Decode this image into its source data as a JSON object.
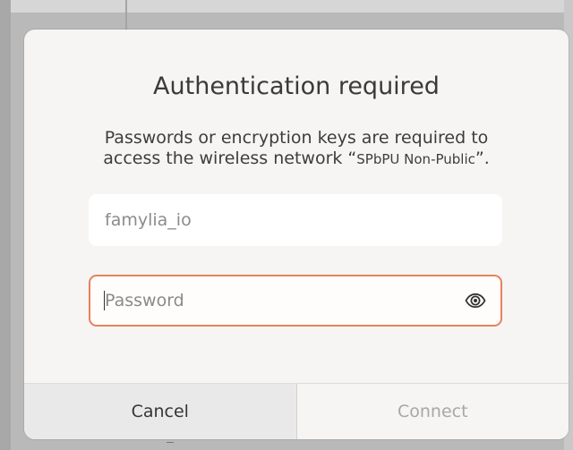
{
  "dialog": {
    "title": "Authentication required",
    "message_line1": "Passwords or encryption keys are required to",
    "message_line2_prefix": "access the wireless network “",
    "network_name": "SPbPU Non-Public",
    "message_line2_suffix": "”.",
    "username": {
      "value": "famylia_io"
    },
    "password": {
      "placeholder": "Password",
      "reveal_icon": "eye-icon"
    },
    "buttons": {
      "cancel_label": "Cancel",
      "connect_label": "Connect"
    }
  },
  "colors": {
    "focus_border": "#e8815c",
    "dialog_bg": "#f6f5f4",
    "disabled_text": "#a7a7a7"
  }
}
